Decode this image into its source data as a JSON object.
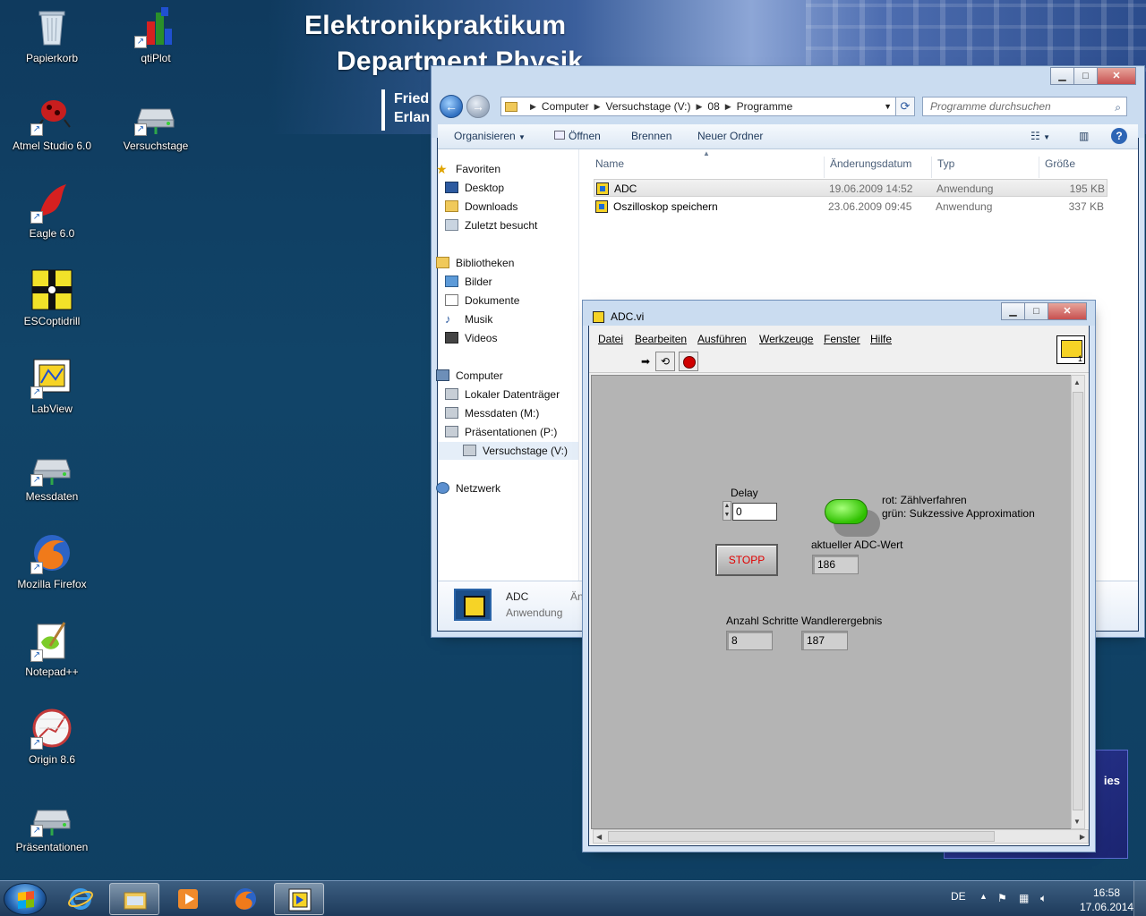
{
  "wallpaper": {
    "title_line1": "Elektronikpraktikum",
    "title_line2": "Department Physik",
    "fau_line1": "Fried",
    "fau_line2": "Erlan",
    "bottom_right_fragment": "ies"
  },
  "desktop_icons": [
    {
      "label": "Papierkorb",
      "icon": "recycle-bin-icon"
    },
    {
      "label": "qtiPlot",
      "icon": "qtiplot-icon"
    },
    {
      "label": "Atmel Studio 6.0",
      "icon": "atmel-studio-icon"
    },
    {
      "label": "Versuchstage",
      "icon": "network-drive-icon"
    },
    {
      "label": "Eagle 6.0",
      "icon": "eagle-icon"
    },
    {
      "label": "ESCoptidrill",
      "icon": "escoptidrill-icon"
    },
    {
      "label": "LabView",
      "icon": "labview-icon"
    },
    {
      "label": "Messdaten",
      "icon": "network-drive-icon"
    },
    {
      "label": "Mozilla Firefox",
      "icon": "firefox-icon"
    },
    {
      "label": "Notepad++",
      "icon": "notepadpp-icon"
    },
    {
      "label": "Origin 8.6",
      "icon": "origin-icon"
    },
    {
      "label": "Präsentationen",
      "icon": "network-drive-icon"
    }
  ],
  "explorer": {
    "address": [
      "Computer",
      "Versuchstage (V:)",
      "08",
      "Programme"
    ],
    "search_placeholder": "Programme durchsuchen",
    "toolbar": {
      "organize": "Organisieren",
      "open": "Öffnen",
      "burn": "Brennen",
      "new_folder": "Neuer Ordner"
    },
    "sidebar": {
      "favorites": "Favoriten",
      "desktop": "Desktop",
      "downloads": "Downloads",
      "recent": "Zuletzt besucht",
      "libraries": "Bibliotheken",
      "pictures": "Bilder",
      "documents": "Dokumente",
      "music": "Musik",
      "videos": "Videos",
      "computer": "Computer",
      "local_disk": "Lokaler Datenträger",
      "messdaten": "Messdaten (M:)",
      "praesentationen": "Präsentationen (P:)",
      "versuchstage": "Versuchstage (V:)",
      "network": "Netzwerk"
    },
    "columns": {
      "name": "Name",
      "date": "Änderungsdatum",
      "type": "Typ",
      "size": "Größe"
    },
    "files": [
      {
        "name": "ADC",
        "date": "19.06.2009 14:52",
        "type": "Anwendung",
        "size": "195 KB"
      },
      {
        "name": "Oszilloskop speichern",
        "date": "23.06.2009 09:45",
        "type": "Anwendung",
        "size": "337 KB"
      }
    ],
    "details": {
      "name": "ADC",
      "type": "Anwendung",
      "extra": "Än"
    }
  },
  "adc_window": {
    "title": "ADC.vi",
    "menus": [
      "Datei",
      "Bearbeiten",
      "Ausführen",
      "Werkzeuge",
      "Fenster",
      "Hilfe"
    ],
    "vi_icon_number": "1",
    "delay_label": "Delay",
    "delay_value": "0",
    "stop_label": "STOPP",
    "switch_text_red": "rot: Zählverfahren",
    "switch_text_green": "grün: Sukzessive Approximation",
    "adc_label": "aktueller ADC-Wert",
    "adc_value": "186",
    "steps_label": "Anzahl Schritte",
    "steps_value": "8",
    "result_label": "Wandlerergebnis",
    "result_value": "187",
    "switch_state": "green"
  },
  "taskbar": {
    "language": "DE",
    "time": "16:58",
    "date": "17.06.2014"
  },
  "colors": {
    "desktop": "#114468",
    "panel_gray": "#b4b4b4",
    "stop_text": "#e00000",
    "switch_green": "#2fc000"
  }
}
